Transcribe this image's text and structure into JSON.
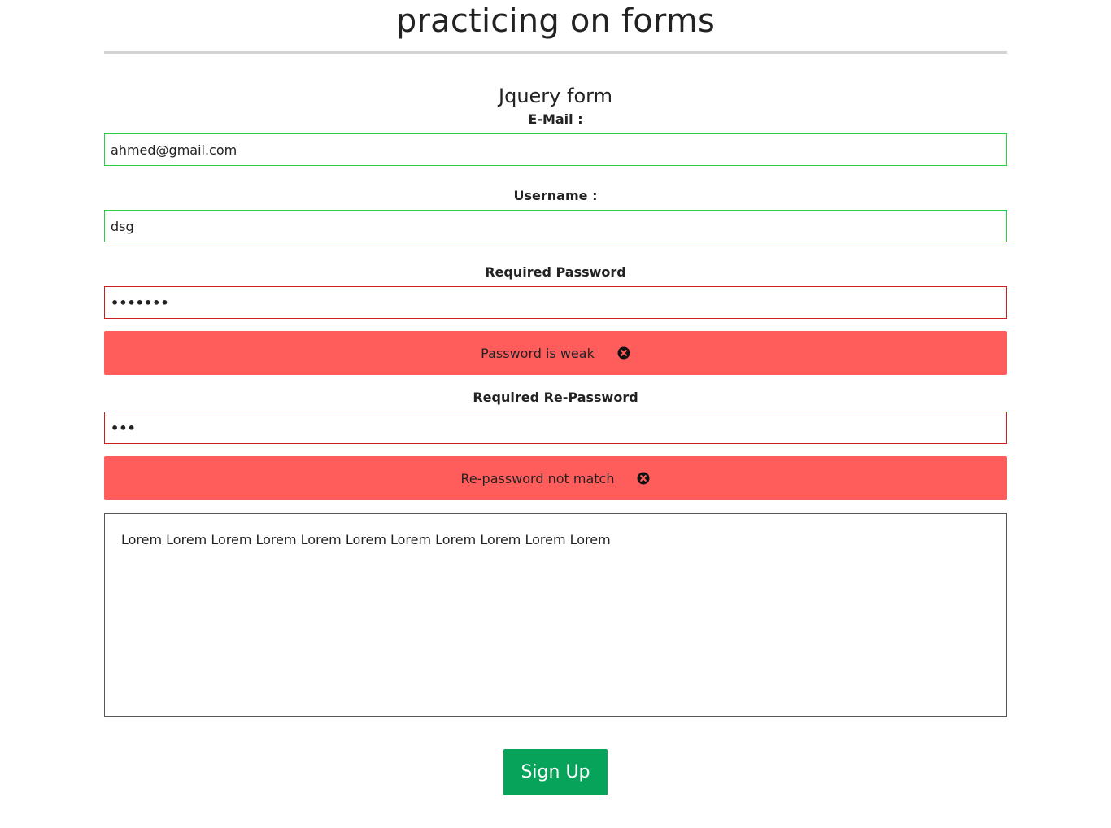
{
  "page": {
    "title": "practicing on forms",
    "form_title": "Jquery form"
  },
  "fields": {
    "email": {
      "label": "E-Mail :",
      "value": "ahmed@gmail.com",
      "state": "valid"
    },
    "username": {
      "label": "Username :",
      "value": "dsg",
      "state": "valid"
    },
    "password": {
      "label": "Required Password",
      "value_masked": "•••••••",
      "state": "invalid",
      "error": "Password is weak"
    },
    "repassword": {
      "label": "Required Re-Password",
      "value_masked": "•••",
      "state": "invalid",
      "error": "Re-password not match"
    },
    "message": {
      "value": "Lorem Lorem Lorem Lorem Lorem Lorem Lorem Lorem Lorem Lorem Lorem"
    }
  },
  "actions": {
    "submit_label": "Sign Up"
  },
  "icons": {
    "error_dismiss": "close-circle-icon"
  },
  "colors": {
    "valid_border": "#2ecc40",
    "invalid_border": "#cc2020",
    "error_background": "#ff5c5c",
    "button_background": "#08a35a",
    "rule": "#d3d3d3"
  }
}
